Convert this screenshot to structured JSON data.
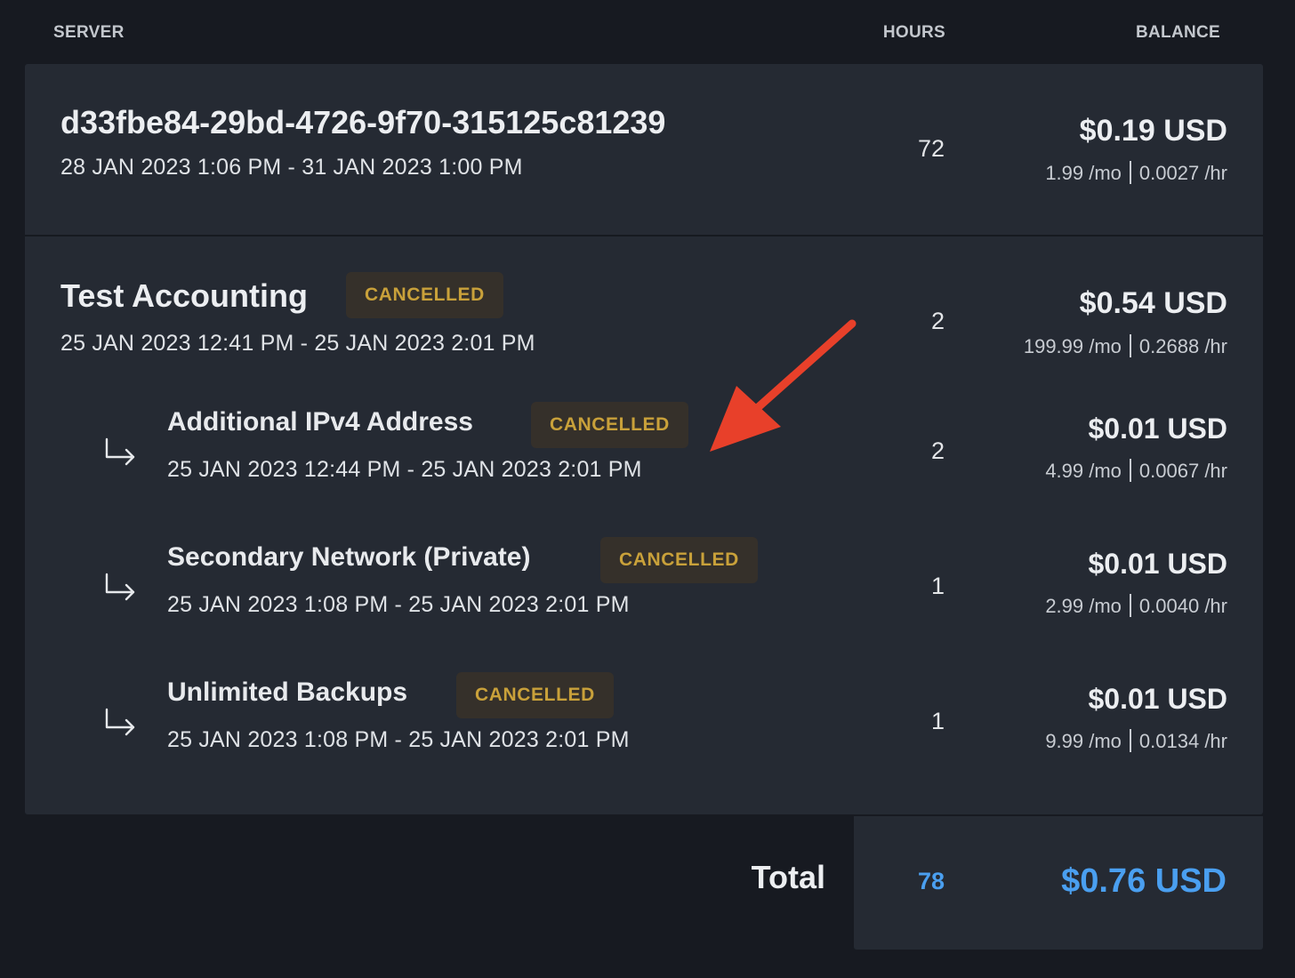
{
  "columns": {
    "server": "SERVER",
    "hours": "HOURS",
    "balance": "BALANCE"
  },
  "servers": [
    {
      "title": "d33fbe84-29bd-4726-9f70-315125c81239",
      "dates": "28 JAN 2023 1:06 PM - 31 JAN 2023 1:00 PM",
      "hours": "72",
      "amount": "$0.19 USD",
      "monthly": "1.99 /mo",
      "hourly": "0.0027 /hr"
    },
    {
      "title": "Test Accounting",
      "badge": "CANCELLED",
      "dates": "25 JAN 2023 12:41 PM - 25 JAN 2023 2:01 PM",
      "hours": "2",
      "amount": "$0.54 USD",
      "monthly": "199.99 /mo",
      "hourly": "0.2688 /hr",
      "addons": [
        {
          "title": "Additional IPv4 Address",
          "badge": "CANCELLED",
          "dates": "25 JAN 2023 12:44 PM - 25 JAN 2023 2:01 PM",
          "hours": "2",
          "amount": "$0.01 USD",
          "monthly": "4.99 /mo",
          "hourly": "0.0067 /hr"
        },
        {
          "title": "Secondary Network (Private)",
          "badge": "CANCELLED",
          "dates": "25 JAN 2023 1:08 PM - 25 JAN 2023 2:01 PM",
          "hours": "1",
          "amount": "$0.01 USD",
          "monthly": "2.99 /mo",
          "hourly": "0.0040 /hr"
        },
        {
          "title": "Unlimited Backups",
          "badge": "CANCELLED",
          "dates": "25 JAN 2023 1:08 PM - 25 JAN 2023 2:01 PM",
          "hours": "1",
          "amount": "$0.01 USD",
          "monthly": "9.99 /mo",
          "hourly": "0.0134 /hr"
        }
      ]
    }
  ],
  "total": {
    "label": "Total",
    "hours": "78",
    "amount": "$0.76 USD"
  },
  "colors": {
    "accent": "#4a9ff0",
    "badge_text": "#c9a13a",
    "badge_bg": "#35302a",
    "annotation_arrow": "#e8402a"
  },
  "icons": {
    "addon": "return-arrow-icon",
    "annotation": "red-pointer-arrow"
  }
}
